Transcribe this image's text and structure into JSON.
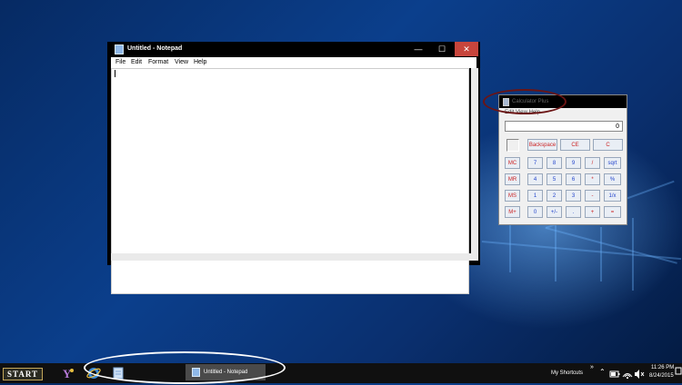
{
  "notepad": {
    "title": "Untitled - Notepad",
    "minimize": "—",
    "maximize": "☐",
    "close": "✕",
    "menu": [
      "File",
      "Edit",
      "Format",
      "View",
      "Help"
    ]
  },
  "calculator": {
    "title": "Calculator Plus",
    "menu": "Edit   View   Help",
    "display": "0",
    "buttons": [
      {
        "label": "Backspace",
        "color": "red"
      },
      {
        "label": "CE",
        "color": "red"
      },
      {
        "label": "C",
        "color": "red"
      },
      {
        "label": "MC",
        "color": "red"
      },
      {
        "label": "7",
        "color": "blue"
      },
      {
        "label": "8",
        "color": "blue"
      },
      {
        "label": "9",
        "color": "blue"
      },
      {
        "label": "/",
        "color": "red"
      },
      {
        "label": "sqrt",
        "color": "blue"
      },
      {
        "label": "MR",
        "color": "red"
      },
      {
        "label": "4",
        "color": "blue"
      },
      {
        "label": "5",
        "color": "blue"
      },
      {
        "label": "6",
        "color": "blue"
      },
      {
        "label": "*",
        "color": "red"
      },
      {
        "label": "%",
        "color": "blue"
      },
      {
        "label": "MS",
        "color": "red"
      },
      {
        "label": "1",
        "color": "blue"
      },
      {
        "label": "2",
        "color": "blue"
      },
      {
        "label": "3",
        "color": "blue"
      },
      {
        "label": "-",
        "color": "red"
      },
      {
        "label": "1/x",
        "color": "blue"
      },
      {
        "label": "M+",
        "color": "red"
      },
      {
        "label": "0",
        "color": "blue"
      },
      {
        "label": "+/-",
        "color": "blue"
      },
      {
        "label": ".",
        "color": "blue"
      },
      {
        "label": "+",
        "color": "red"
      },
      {
        "label": "=",
        "color": "red"
      }
    ]
  },
  "taskbar": {
    "start_label": "START",
    "task_label": "Untitled - Notepad",
    "shortcuts_label": "My Shortcuts",
    "time": "11:26 PM",
    "date": "8/24/2015"
  },
  "colors": {
    "highlight_calculator": "#6b1414",
    "highlight_taskbar": "#ffffff",
    "close_button": "#c7453c"
  }
}
